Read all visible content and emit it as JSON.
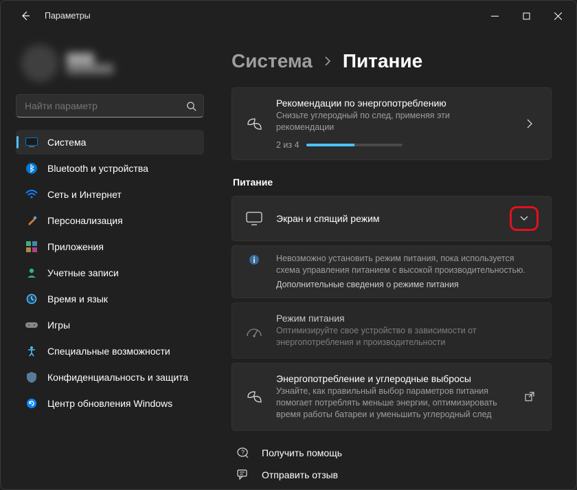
{
  "window": {
    "title": "Параметры"
  },
  "search": {
    "placeholder": "Найти параметр"
  },
  "sidebar": {
    "items": [
      {
        "label": "Система"
      },
      {
        "label": "Bluetooth и устройства"
      },
      {
        "label": "Сеть и Интернет"
      },
      {
        "label": "Персонализация"
      },
      {
        "label": "Приложения"
      },
      {
        "label": "Учетные записи"
      },
      {
        "label": "Время и язык"
      },
      {
        "label": "Игры"
      },
      {
        "label": "Специальные возможности"
      },
      {
        "label": "Конфиденциальность и защита"
      },
      {
        "label": "Центр обновления Windows"
      }
    ]
  },
  "breadcrumb": {
    "parent": "Система",
    "current": "Питание"
  },
  "reco": {
    "title": "Рекомендации по энергопотреблению",
    "desc": "Снизьте углеродный по след, применяя эти рекомендации",
    "progress_text": "2 из 4"
  },
  "section": {
    "power": "Питание"
  },
  "screen_sleep": {
    "title": "Экран и спящий режим"
  },
  "info": {
    "text": "Невозможно установить режим питания, пока используется схема управления питанием с высокой производительностью.",
    "link": "Дополнительные сведения о режиме питания"
  },
  "power_mode": {
    "title": "Режим питания",
    "desc": "Оптимизируйте свое устройство в зависимости от энергопотребления и производительности"
  },
  "carbon": {
    "title": "Энергопотребление и углеродные выбросы",
    "desc": "Узнайте, как правильный выбор параметров питания помогает потреблять меньше энергии, оптимизировать время работы батареи и уменьшить углеродный след"
  },
  "footer": {
    "help": "Получить помощь",
    "feedback": "Отправить отзыв"
  }
}
